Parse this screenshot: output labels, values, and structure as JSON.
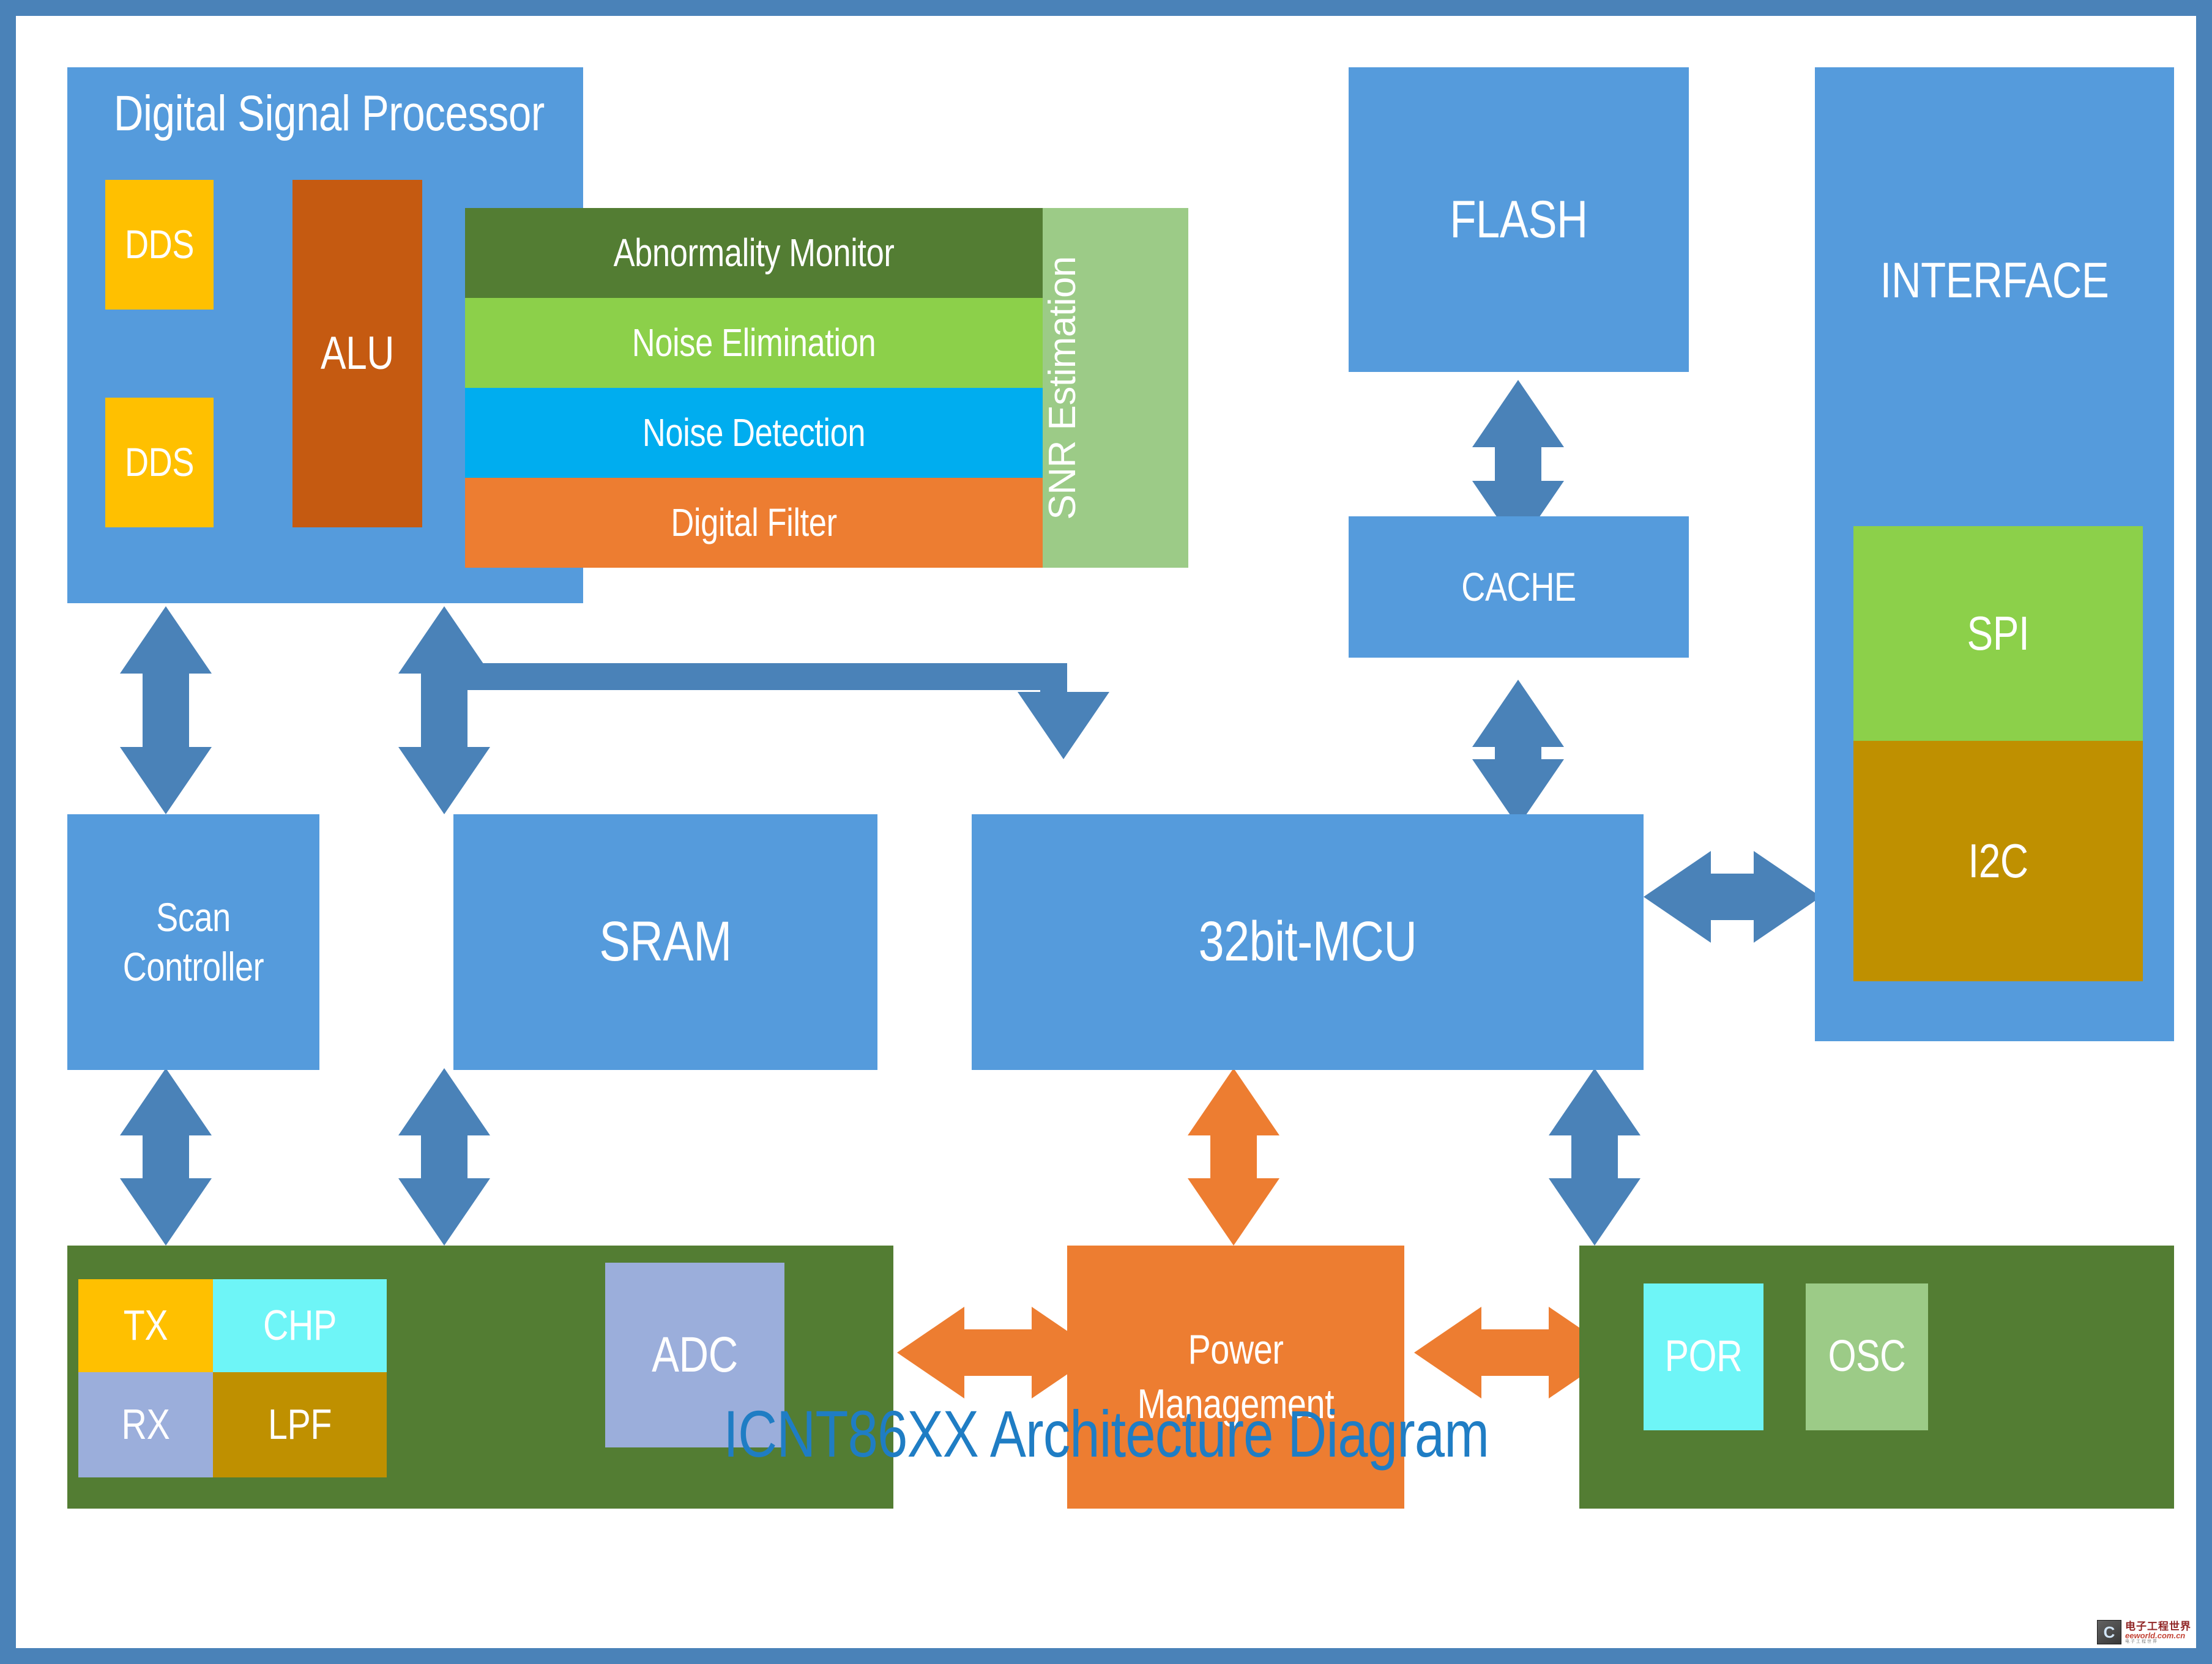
{
  "title": "ICNT86XX Architecture Diagram",
  "colors": {
    "frame_blue": "#4A82B8",
    "block_blue": "#559BDC",
    "arrow_blue": "#4A82B8",
    "arrow_orange": "#ED7D31",
    "yellow": "#FFC000",
    "brown": "#C55A11",
    "dark_green": "#537D33",
    "light_green": "#8CD04A",
    "cyan": "#00ADEF",
    "orange": "#ED7D31",
    "pale_green": "#9CCB87",
    "olive": "#BF9000",
    "periwinkle": "#9BAEDB",
    "aqua": "#6EF5F7",
    "title_blue": "#1F7DC4"
  },
  "dsp": {
    "title": "Digital Signal Processor",
    "dds_top": "DDS",
    "dds_bottom": "DDS",
    "alu": "ALU",
    "pipeline": [
      {
        "label": "Abnormality Monitor",
        "color": "#537D33"
      },
      {
        "label": "Noise Elimination",
        "color": "#8CD04A"
      },
      {
        "label": "Noise Detection",
        "color": "#00ADEF"
      },
      {
        "label": "Digital Filter",
        "color": "#ED7D31"
      }
    ],
    "snr": "SNR Estimation"
  },
  "memory": {
    "flash": "FLASH",
    "cache": "CACHE"
  },
  "interface": {
    "title": "INTERFACE",
    "buses": [
      {
        "label": "SPI",
        "color": "#8CD04A"
      },
      {
        "label": "I2C",
        "color": "#BF9000"
      }
    ]
  },
  "core": {
    "scan_controller_line1": "Scan",
    "scan_controller_line2": "Controller",
    "sram": "SRAM",
    "mcu": "32bit-MCU"
  },
  "analog": {
    "tx": "TX",
    "chp": "CHP",
    "rx": "RX",
    "lpf": "LPF",
    "adc": "ADC"
  },
  "power": {
    "line1": "Power",
    "line2": "Management"
  },
  "clockreset": {
    "por": "POR",
    "osc": "OSC"
  },
  "watermark": {
    "badge": "C",
    "cn": "电子工程世界",
    "en": "eeworld.com.cn",
    "sub": "电子工程世界"
  }
}
